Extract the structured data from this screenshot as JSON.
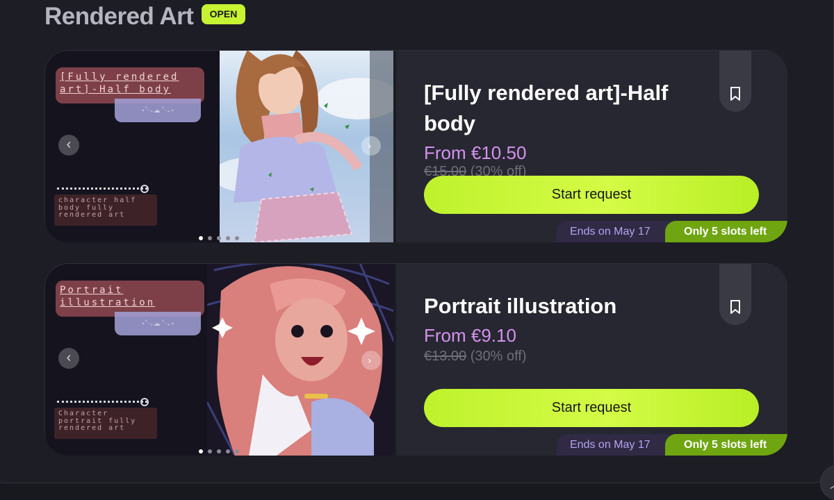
{
  "section": {
    "title": "Rendered Art",
    "status_badge": "OPEN"
  },
  "offers": [
    {
      "title": "[Fully rendered art]-Half body",
      "price": "From €10.50",
      "old_price": "€15.00",
      "discount": "(30% off)",
      "cta_label": "Start request",
      "ends_label": "Ends on May 17",
      "slots_label": "Only 5 slots left",
      "thumbnail": {
        "label": "[Fully rendered art]-Half body",
        "description": "character half body fully rendered art",
        "sub_deco": "⋆˚‧₊☁︎ ˚‧₊⋆"
      },
      "carousel_dots": 5,
      "active_dot": 0,
      "icons": [
        "chevron-left-icon",
        "chevron-right-icon",
        "bookmark-icon"
      ]
    },
    {
      "title": "Portrait illustration",
      "price": "From €9.10",
      "old_price": "€13.00",
      "discount": "(30% off)",
      "cta_label": "Start request",
      "ends_label": "Ends on May 17",
      "slots_label": "Only 5 slots left",
      "thumbnail": {
        "label": "Portrait illustration",
        "description": "Character portrait fully rendered art",
        "sub_deco": "⋆˚‧₊☁︎ ˚‧₊⋆"
      },
      "carousel_dots": 5,
      "active_dot": 0,
      "icons": [
        "chevron-left-icon",
        "chevron-right-icon",
        "bookmark-icon"
      ]
    }
  ],
  "colors": {
    "accent": "#c6f432",
    "price": "#d492ef",
    "slots_badge": "#6fa511",
    "ends_badge": "#302a45"
  }
}
